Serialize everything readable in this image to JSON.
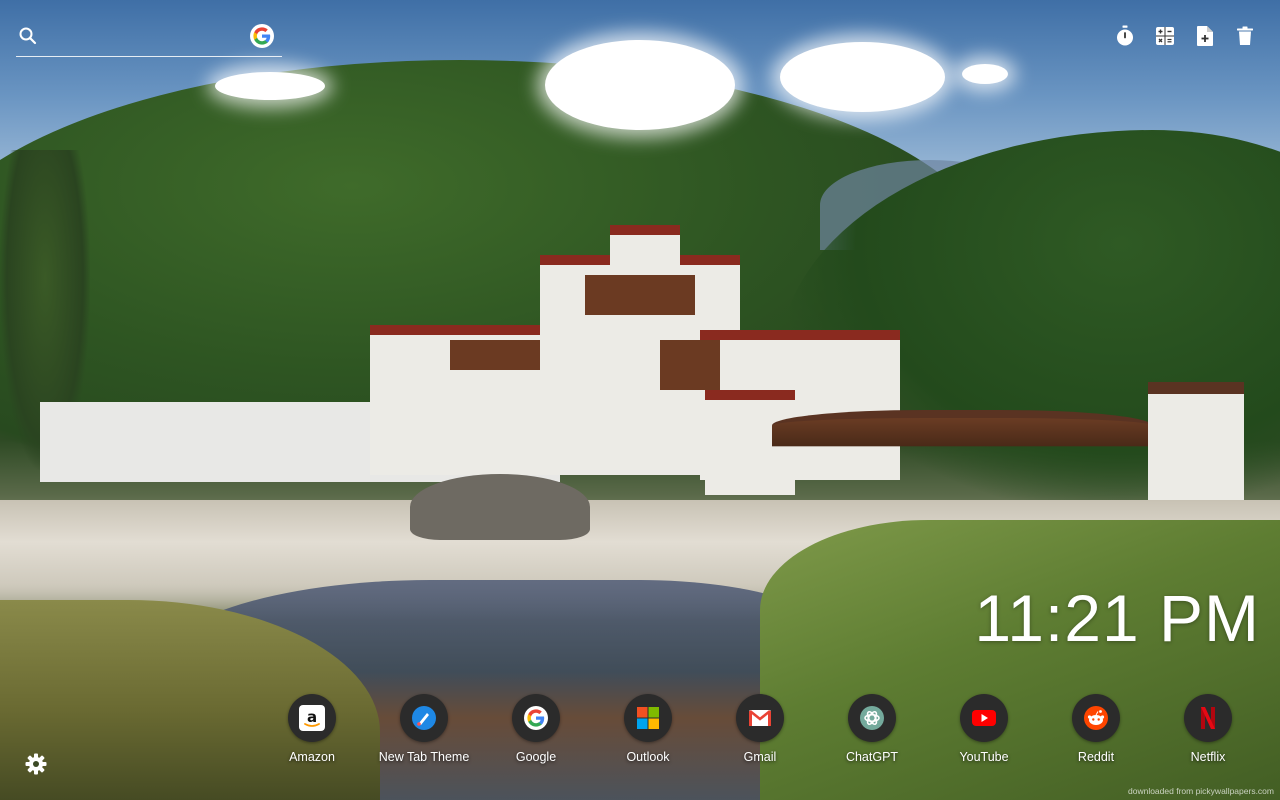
{
  "search": {
    "placeholder": "",
    "value": "",
    "engine_icon": "google-icon"
  },
  "toolbar": {
    "items": [
      {
        "name": "timer-icon"
      },
      {
        "name": "calculator-icon"
      },
      {
        "name": "file-add-icon"
      },
      {
        "name": "trash-icon"
      }
    ]
  },
  "clock": {
    "time": "11:21 PM"
  },
  "shortcuts": [
    {
      "label": "Amazon",
      "icon": "amazon-icon",
      "color": "#ffffff"
    },
    {
      "label": "New Tab Theme",
      "icon": "new-tab-theme-icon",
      "color": "#1e88e5"
    },
    {
      "label": "Google",
      "icon": "google-icon",
      "color": "#ffffff"
    },
    {
      "label": "Outlook",
      "icon": "microsoft-icon",
      "color": "#f25022"
    },
    {
      "label": "Gmail",
      "icon": "gmail-icon",
      "color": "#ea4335"
    },
    {
      "label": "ChatGPT",
      "icon": "chatgpt-icon",
      "color": "#74aa9c"
    },
    {
      "label": "YouTube",
      "icon": "youtube-icon",
      "color": "#ff0000"
    },
    {
      "label": "Reddit",
      "icon": "reddit-icon",
      "color": "#ff4500"
    },
    {
      "label": "Netflix",
      "icon": "netflix-icon",
      "color": "#e50914"
    }
  ],
  "settings": {
    "icon": "gear-icon"
  },
  "watermark": {
    "text": "downloaded from pickywallpapers.com"
  }
}
